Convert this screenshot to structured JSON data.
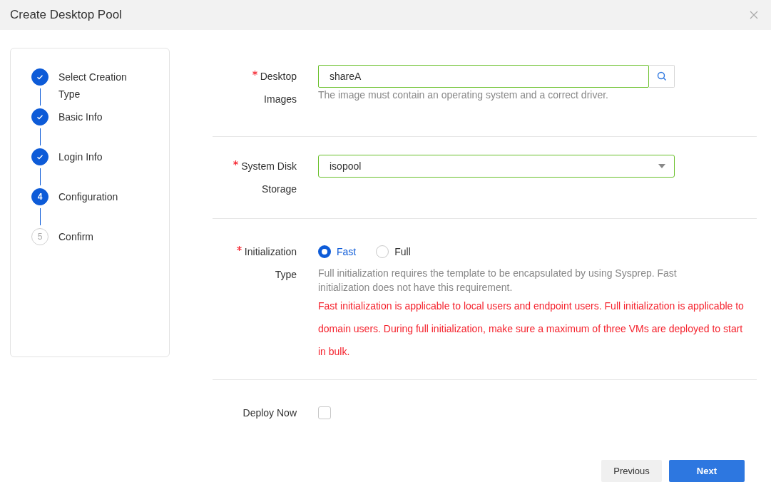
{
  "dialog": {
    "title": "Create Desktop Pool"
  },
  "steps": [
    {
      "label": "Select Creation Type",
      "kind": "done"
    },
    {
      "label": "Basic Info",
      "kind": "done"
    },
    {
      "label": "Login Info",
      "kind": "done"
    },
    {
      "label": "Configuration",
      "kind": "current",
      "number": "4"
    },
    {
      "label": "Confirm",
      "kind": "pending",
      "number": "5"
    }
  ],
  "fields": [
    {
      "kind": "search",
      "label": "Desktop Images",
      "required": true,
      "value": "shareA",
      "hint": "The image must contain an operating system and a correct driver."
    },
    {
      "kind": "select",
      "label": "System Disk Storage",
      "required": true,
      "value": "isopool"
    },
    {
      "kind": "radio",
      "label": "Initialization Type",
      "required": true,
      "options": [
        {
          "label": "Fast",
          "selected": true
        },
        {
          "label": "Full",
          "selected": false
        }
      ],
      "hint": "Full initialization requires the template to be encapsulated by using Sysprep. Fast initialization does not have this requirement.",
      "warning": "Fast initialization is applicable to local users and endpoint users. Full initialization is applicable to domain users. During full initialization, make sure a maximum of three VMs are deployed to start in bulk."
    },
    {
      "kind": "checkbox",
      "label": "Deploy Now",
      "required": false,
      "checked": false
    }
  ],
  "buttons": [
    {
      "label": "Previous",
      "kind": "secondary"
    },
    {
      "label": "Next",
      "kind": "primary"
    }
  ]
}
